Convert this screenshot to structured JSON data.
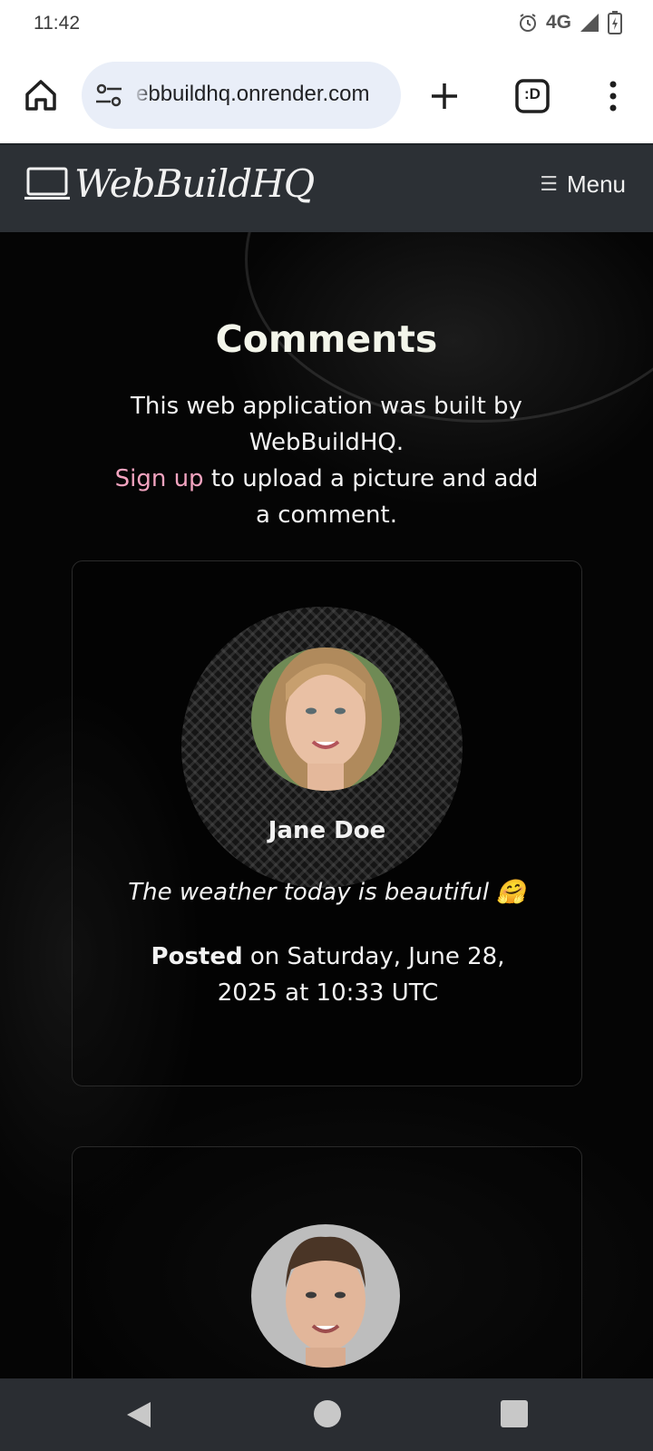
{
  "status_bar": {
    "time": "11:42",
    "network": "4G",
    "icons": [
      "alarm-icon",
      "signal-icon",
      "battery-charging-icon"
    ]
  },
  "browser": {
    "url": "ebbuildhq.onrender.com",
    "tab_count_label": ":D",
    "icons": [
      "home-icon",
      "site-settings-icon",
      "new-tab-icon",
      "tab-switcher-icon",
      "more-vert-icon"
    ]
  },
  "navbar": {
    "brand": "WebBuildHQ",
    "menu_label": "Menu",
    "bg_color": "#2c3035"
  },
  "page": {
    "title": "Comments",
    "intro_line1": "This web application was built by WebBuildHQ.",
    "signup_link": "Sign up",
    "intro_line2": " to upload a picture and add a comment.",
    "link_color": "#f2a3bf"
  },
  "comments": [
    {
      "name": "Jane Doe",
      "text": "The weather today is beautiful 🤗",
      "posted_label": "Posted",
      "posted_rest": " on Saturday, June 28, 2025 at 10:33 UTC"
    },
    {
      "name": "",
      "text": "",
      "posted_label": "",
      "posted_rest": ""
    }
  ],
  "system_nav": {
    "icons": [
      "back-icon",
      "home-circle-icon",
      "recents-icon"
    ]
  }
}
